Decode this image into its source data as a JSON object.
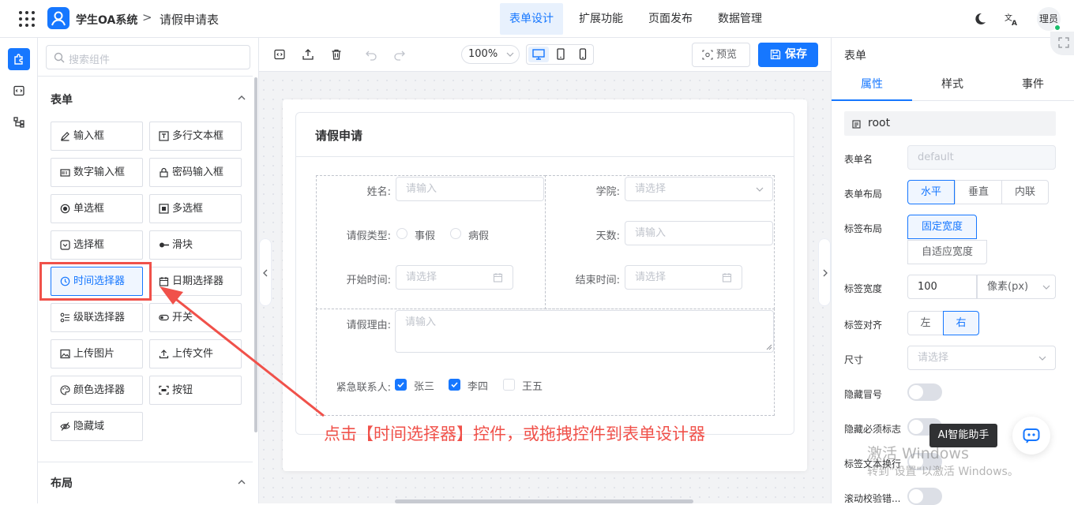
{
  "app": {
    "name": "学生OA系统",
    "separator": ">",
    "page": "请假申请表"
  },
  "top_nav": [
    {
      "label": "表单设计",
      "active": true
    },
    {
      "label": "扩展功能",
      "active": false
    },
    {
      "label": "页面发布",
      "active": false
    },
    {
      "label": "数据管理",
      "active": false
    }
  ],
  "user": {
    "name": "理员"
  },
  "accent_color": "#1677ff",
  "annotation_color": "#f0514a",
  "component_panel": {
    "search_placeholder": "搜索组件",
    "group_form": "表单",
    "group_layout": "布局",
    "components": [
      {
        "label": "输入框",
        "icon": "pencil-icon"
      },
      {
        "label": "多行文本框",
        "icon": "textarea-icon"
      },
      {
        "label": "数字输入框",
        "icon": "number-icon"
      },
      {
        "label": "密码输入框",
        "icon": "lock-icon"
      },
      {
        "label": "单选框",
        "icon": "radio-icon"
      },
      {
        "label": "多选框",
        "icon": "checkbox-icon"
      },
      {
        "label": "选择框",
        "icon": "select-icon"
      },
      {
        "label": "滑块",
        "icon": "slider-icon"
      },
      {
        "label": "时间选择器",
        "icon": "clock-icon",
        "highlighted": true
      },
      {
        "label": "日期选择器",
        "icon": "calendar-icon"
      },
      {
        "label": "级联选择器",
        "icon": "cascader-icon"
      },
      {
        "label": "开关",
        "icon": "switch-icon"
      },
      {
        "label": "上传图片",
        "icon": "image-icon"
      },
      {
        "label": "上传文件",
        "icon": "upload-icon"
      },
      {
        "label": "颜色选择器",
        "icon": "palette-icon"
      },
      {
        "label": "按钮",
        "icon": "button-icon"
      },
      {
        "label": "隐藏域",
        "icon": "eye-off-icon"
      }
    ]
  },
  "toolbar": {
    "zoom": "100%",
    "preview": "预览",
    "save": "保存"
  },
  "form": {
    "title": "请假申请",
    "fields": {
      "name_label": "姓名:",
      "name_placeholder": "请输入",
      "college_label": "学院:",
      "college_placeholder": "请选择",
      "leave_type_label": "请假类型:",
      "leave_type_options": [
        "事假",
        "病假"
      ],
      "days_label": "天数:",
      "days_placeholder": "请输入",
      "start_label": "开始时间:",
      "start_placeholder": "请选择",
      "end_label": "结束时间:",
      "end_placeholder": "请选择",
      "reason_label": "请假理由:",
      "reason_placeholder": "请输入",
      "contact_label": "紧急联系人:",
      "contact_options": [
        {
          "label": "张三",
          "checked": true
        },
        {
          "label": "李四",
          "checked": true
        },
        {
          "label": "王五",
          "checked": false
        }
      ]
    }
  },
  "annotation": "点击【时间选择器】控件，或拖拽控件到表单设计器",
  "props_panel": {
    "title": "表单",
    "tabs": [
      {
        "label": "属性",
        "active": true
      },
      {
        "label": "样式",
        "active": false
      },
      {
        "label": "事件",
        "active": false
      }
    ],
    "root": "root",
    "form_name_label": "表单名",
    "form_name_value": "default",
    "form_layout_label": "表单布局",
    "form_layout_options": [
      "水平",
      "垂直",
      "内联"
    ],
    "form_layout_selected": "水平",
    "label_layout_label": "标签布局",
    "label_layout_options": [
      "固定宽度",
      "自适应宽度"
    ],
    "label_layout_selected": "固定宽度",
    "label_width_label": "标签宽度",
    "label_width_value": "100",
    "label_width_unit": "像素(px)",
    "label_align_label": "标签对齐",
    "label_align_options": [
      "左",
      "右"
    ],
    "label_align_selected": "右",
    "size_label": "尺寸",
    "size_placeholder": "请选择",
    "hide_colon_label": "隐藏冒号",
    "hide_required_label": "隐藏必须标志",
    "label_wrap_label": "标签文本换行",
    "scroll_validate_label": "滚动校验错..."
  },
  "ai_assistant": {
    "label": "AI智能助手"
  },
  "watermark": {
    "line1": "激活 Windows",
    "line2": "转到\"设置\"以激活 Windows。"
  }
}
